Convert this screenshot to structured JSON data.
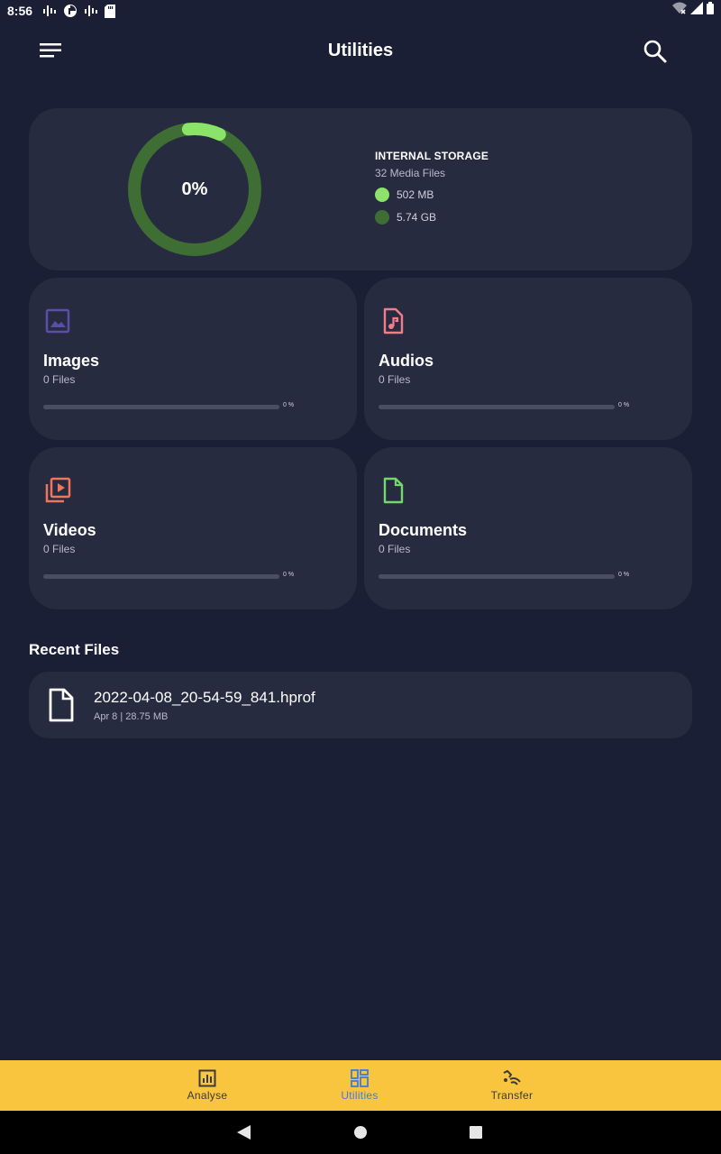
{
  "status_bar": {
    "time": "8:56"
  },
  "app_bar": {
    "title": "Utilities"
  },
  "storage": {
    "percent_label": "0%",
    "title": "INTERNAL STORAGE",
    "media_files": "32 Media Files",
    "used": "502 MB",
    "total": "5.74 GB",
    "used_fraction": 0.085,
    "colors": {
      "used": "#8be36a",
      "total": "#3f6e35"
    }
  },
  "categories": [
    {
      "name": "Images",
      "count": "0 Files",
      "percent": "0 %",
      "progress": 0,
      "icon": "image-icon",
      "color": "#5a4fa8"
    },
    {
      "name": "Audios",
      "count": "0 Files",
      "percent": "0 %",
      "progress": 0,
      "icon": "audio-file-icon",
      "color": "#f27d8a"
    },
    {
      "name": "Videos",
      "count": "0 Files",
      "percent": "0 %",
      "progress": 0,
      "icon": "video-library-icon",
      "color": "#f0755a"
    },
    {
      "name": "Documents",
      "count": "0 Files",
      "percent": "0 %",
      "progress": 0,
      "icon": "document-icon",
      "color": "#72d86a"
    }
  ],
  "recent": {
    "title": "Recent Files",
    "items": [
      {
        "name": "2022-04-08_20-54-59_841.hprof",
        "meta": "Apr 8 | 28.75 MB",
        "icon": "file-icon"
      }
    ]
  },
  "bottom_nav": {
    "items": [
      {
        "label": "Analyse",
        "icon": "analytics-icon",
        "active": false
      },
      {
        "label": "Utilities",
        "icon": "dashboard-icon",
        "active": true
      },
      {
        "label": "Transfer",
        "icon": "transfer-icon",
        "active": false
      }
    ],
    "colors": {
      "background": "#fac53e",
      "active": "#3e7be0"
    }
  }
}
